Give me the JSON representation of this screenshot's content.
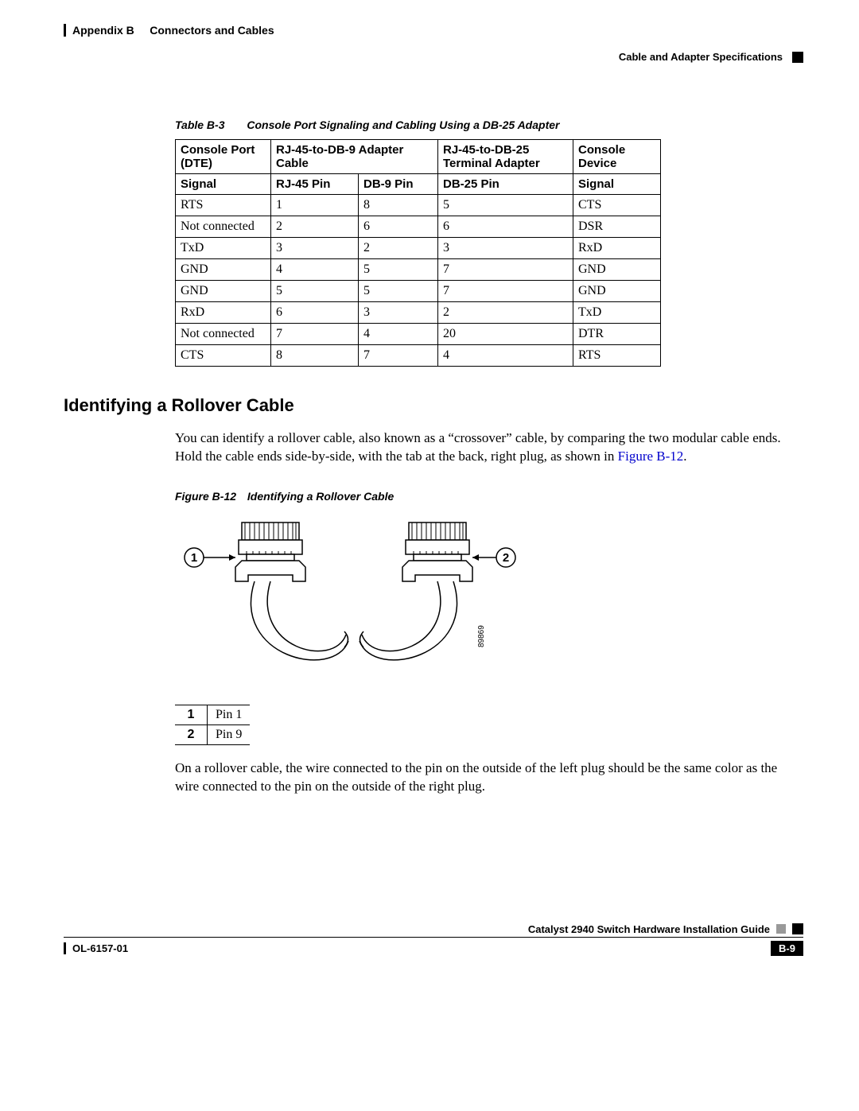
{
  "header": {
    "appendix": "Appendix B",
    "chapter": "Connectors and Cables",
    "section": "Cable and Adapter Specifications"
  },
  "table": {
    "caption_num": "Table B-3",
    "caption_text": "Console Port Signaling and Cabling Using a DB-25 Adapter",
    "groups": {
      "g1": "Console Port (DTE)",
      "g2": "RJ-45-to-DB-9 Adapter Cable",
      "g3": "RJ-45-to-DB-25 Terminal Adapter",
      "g4": "Console Device"
    },
    "cols": {
      "c1": "Signal",
      "c2": "RJ-45 Pin",
      "c3": "DB-9 Pin",
      "c4": "DB-25 Pin",
      "c5": "Signal"
    },
    "rows": [
      {
        "c1": "RTS",
        "c2": "1",
        "c3": "8",
        "c4": "5",
        "c5": "CTS"
      },
      {
        "c1": "Not connected",
        "c2": "2",
        "c3": "6",
        "c4": "6",
        "c5": "DSR"
      },
      {
        "c1": "TxD",
        "c2": "3",
        "c3": "2",
        "c4": "3",
        "c5": "RxD"
      },
      {
        "c1": "GND",
        "c2": "4",
        "c3": "5",
        "c4": "7",
        "c5": "GND"
      },
      {
        "c1": "GND",
        "c2": "5",
        "c3": "5",
        "c4": "7",
        "c5": "GND"
      },
      {
        "c1": "RxD",
        "c2": "6",
        "c3": "3",
        "c4": "2",
        "c5": "TxD"
      },
      {
        "c1": "Not connected",
        "c2": "7",
        "c3": "4",
        "c4": "20",
        "c5": "DTR"
      },
      {
        "c1": "CTS",
        "c2": "8",
        "c3": "7",
        "c4": "4",
        "c5": "RTS"
      }
    ]
  },
  "sect_title": "Identifying a Rollover Cable",
  "para1_a": "You can identify a rollover cable, also known as a “crossover” cable, by comparing the two modular cable ends. Hold the cable ends side-by-side, with the tab at the back, right plug, as shown in ",
  "para1_link": "Figure B-12",
  "para1_c": ".",
  "fig": {
    "caption_num": "Figure B-12",
    "caption_text": "Identifying a Rollover Cable",
    "callout1": "1",
    "callout2": "2",
    "art_id": "89869"
  },
  "callouts": {
    "k1": "1",
    "v1": "Pin 1",
    "k2": "2",
    "v2": "Pin 9"
  },
  "para2": "On a rollover cable, the wire connected to the pin on the outside of the left plug should be the same color as the wire connected to the pin on the outside of the right plug.",
  "footer": {
    "guide": "Catalyst 2940 Switch Hardware Installation Guide",
    "doc": "OL-6157-01",
    "page": "B-9"
  }
}
